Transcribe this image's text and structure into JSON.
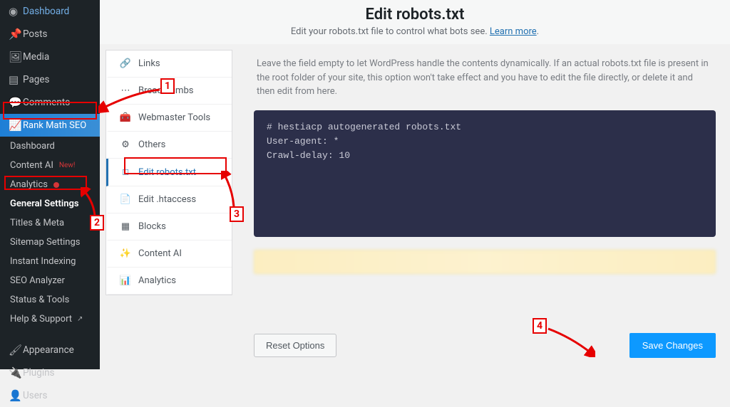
{
  "wp_menu": {
    "dashboard": "Dashboard",
    "posts": "Posts",
    "media": "Media",
    "pages": "Pages",
    "comments": "Comments",
    "rank_math": "Rank Math SEO",
    "appearance": "Appearance",
    "plugins": "Plugins",
    "users": "Users"
  },
  "rm_submenu": {
    "dashboard": "Dashboard",
    "content_ai": "Content AI",
    "content_ai_badge": "New!",
    "analytics": "Analytics",
    "general_settings": "General Settings",
    "titles_meta": "Titles & Meta",
    "sitemap_settings": "Sitemap Settings",
    "instant_indexing": "Instant Indexing",
    "seo_analyzer": "SEO Analyzer",
    "status_tools": "Status & Tools",
    "help_support": "Help & Support"
  },
  "header": {
    "title": "Edit robots.txt",
    "subtitle_before": "Edit your robots.txt file to control what bots see. ",
    "learn_more": "Learn more",
    "subtitle_after": "."
  },
  "tabs": {
    "links": "Links",
    "breadcrumbs": "Breadcrumbs",
    "webmaster_tools": "Webmaster Tools",
    "others": "Others",
    "edit_robots": "Edit robots.txt",
    "edit_htaccess": "Edit .htaccess",
    "blocks": "Blocks",
    "content_ai": "Content AI",
    "analytics": "Analytics"
  },
  "form": {
    "description": "Leave the field empty to let WordPress handle the contents dynamically. If an actual robots.txt file is present in the root folder of your site, this option won't take effect and you have to edit the file directly, or delete it and then edit from here.",
    "robots_content": "# hestiacp autogenerated robots.txt\nUser-agent: *\nCrawl-delay: 10"
  },
  "buttons": {
    "reset": "Reset Options",
    "save": "Save Changes"
  },
  "annotations": {
    "n1": "1",
    "n2": "2",
    "n3": "3",
    "n4": "4"
  }
}
